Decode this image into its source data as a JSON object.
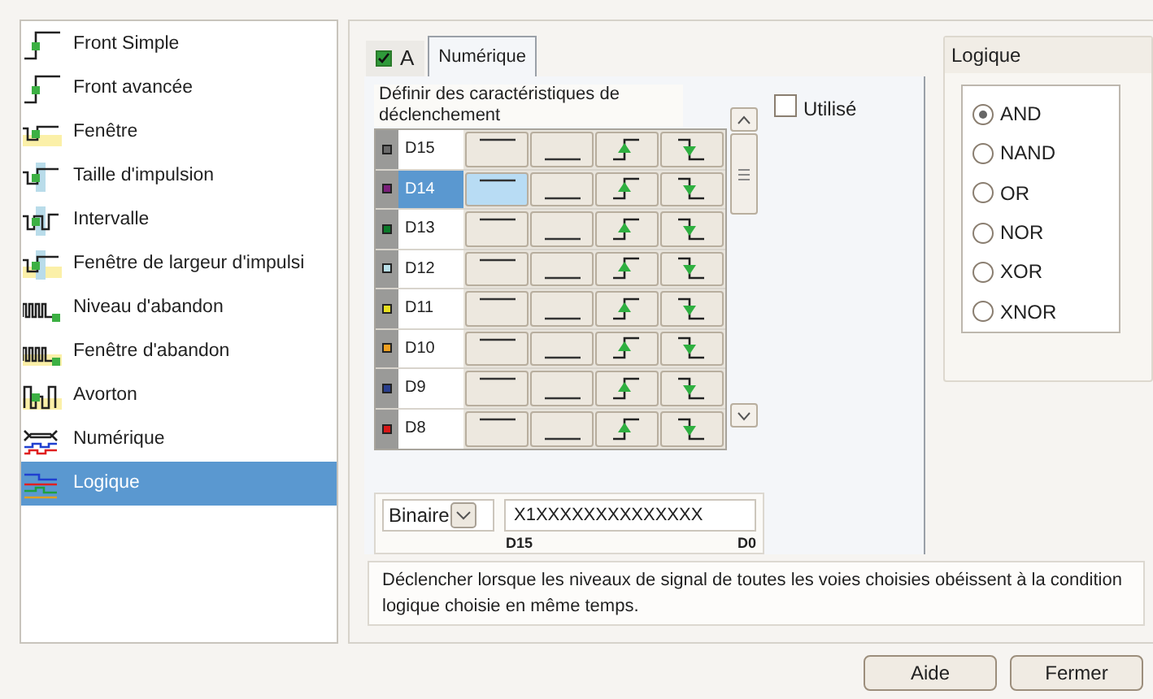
{
  "trigger_types": [
    {
      "label": "Front Simple",
      "kind": "edge",
      "selected": false
    },
    {
      "label": "Front avancée",
      "kind": "edge",
      "selected": false
    },
    {
      "label": "Fenêtre",
      "kind": "window",
      "selected": false
    },
    {
      "label": "Taille d'impulsion",
      "kind": "pulse",
      "selected": false
    },
    {
      "label": "Intervalle",
      "kind": "interval",
      "selected": false
    },
    {
      "label": "Fenêtre de largeur d'impulsi",
      "kind": "pulsewindow",
      "selected": false
    },
    {
      "label": "Niveau d'abandon",
      "kind": "dropout",
      "selected": false
    },
    {
      "label": "Fenêtre d'abandon",
      "kind": "dropoutwindow",
      "selected": false
    },
    {
      "label": "Avorton",
      "kind": "runt",
      "selected": false
    },
    {
      "label": "Numérique",
      "kind": "digital",
      "selected": false
    },
    {
      "label": "Logique",
      "kind": "logic",
      "selected": true
    }
  ],
  "tabs": [
    {
      "label": "A",
      "checked": true,
      "selected": false
    },
    {
      "label": "Numérique",
      "selected": true
    }
  ],
  "table_caption": "Définir des caractéristiques de déclenchement",
  "used": {
    "label": "Utilisé",
    "checked": false
  },
  "channels": [
    {
      "name": "D15",
      "color": "#6b6b6b",
      "selected": false,
      "high_selected": false
    },
    {
      "name": "D14",
      "color": "#7b1f7b",
      "selected": true,
      "high_selected": true
    },
    {
      "name": "D13",
      "color": "#0b7a2a",
      "selected": false,
      "high_selected": false
    },
    {
      "name": "D12",
      "color": "#b8dfe8",
      "selected": false,
      "high_selected": false
    },
    {
      "name": "D11",
      "color": "#e8e020",
      "selected": false,
      "high_selected": false
    },
    {
      "name": "D10",
      "color": "#f0a020",
      "selected": false,
      "high_selected": false
    },
    {
      "name": "D9",
      "color": "#2a3f8f",
      "selected": false,
      "high_selected": false
    },
    {
      "name": "D8",
      "color": "#d81818",
      "selected": false,
      "high_selected": false
    }
  ],
  "format": {
    "value": "Binaire"
  },
  "pattern": {
    "value": "X1XXXXXXXXXXXXXX",
    "start_label": "D15",
    "end_label": "D0"
  },
  "logic": {
    "title": "Logique",
    "options": [
      {
        "label": "AND",
        "selected": true
      },
      {
        "label": "NAND",
        "selected": false
      },
      {
        "label": "OR",
        "selected": false
      },
      {
        "label": "NOR",
        "selected": false
      },
      {
        "label": "XOR",
        "selected": false
      },
      {
        "label": "XNOR",
        "selected": false
      }
    ]
  },
  "description": "Déclencher lorsque les niveaux de signal de toutes les voies choisies obéissent à la condition logique choisie en même temps.",
  "buttons": [
    "Aide",
    "Fermer"
  ]
}
